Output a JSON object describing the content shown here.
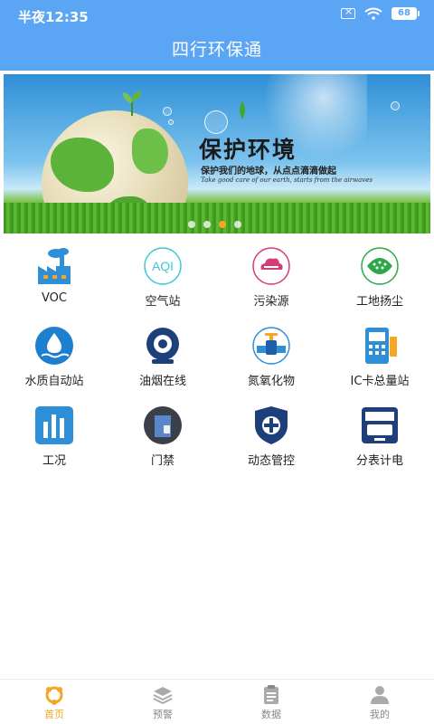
{
  "status_bar": {
    "time": "半夜12:35",
    "battery": "68"
  },
  "header": {
    "title": "四行环保通"
  },
  "banner": {
    "title": "保护环境",
    "subtitle": "保护我们的地球，从点点滴滴做起",
    "english": "Take good care of our earth, starts from the airwaves",
    "active_dot": 2
  },
  "features": [
    {
      "label": "VOC",
      "icon": "factory-icon"
    },
    {
      "label": "空气站",
      "icon": "aqi-icon"
    },
    {
      "label": "污染源",
      "icon": "pollution-cloud-icon"
    },
    {
      "label": "工地扬尘",
      "icon": "dust-icon"
    },
    {
      "label": "水质自动站",
      "icon": "water-drop-icon"
    },
    {
      "label": "油烟在线",
      "icon": "fume-sensor-icon"
    },
    {
      "label": "氮氧化物",
      "icon": "pipeline-icon"
    },
    {
      "label": "IC卡总量站",
      "icon": "ic-card-icon"
    },
    {
      "label": "工况",
      "icon": "bar-chart-icon"
    },
    {
      "label": "门禁",
      "icon": "access-door-icon"
    },
    {
      "label": "动态管控",
      "icon": "shield-icon"
    },
    {
      "label": "分表计电",
      "icon": "meter-icon"
    }
  ],
  "bottom_nav": [
    {
      "label": "首页",
      "icon": "home-icon",
      "active": true
    },
    {
      "label": "预警",
      "icon": "layers-icon",
      "active": false
    },
    {
      "label": "数据",
      "icon": "clipboard-icon",
      "active": false
    },
    {
      "label": "我的",
      "icon": "user-icon",
      "active": false
    }
  ],
  "colors": {
    "header": "#5ba5f5",
    "accent": "#f5a623",
    "brand_blue": "#2f8fd6",
    "text": "#222222"
  }
}
